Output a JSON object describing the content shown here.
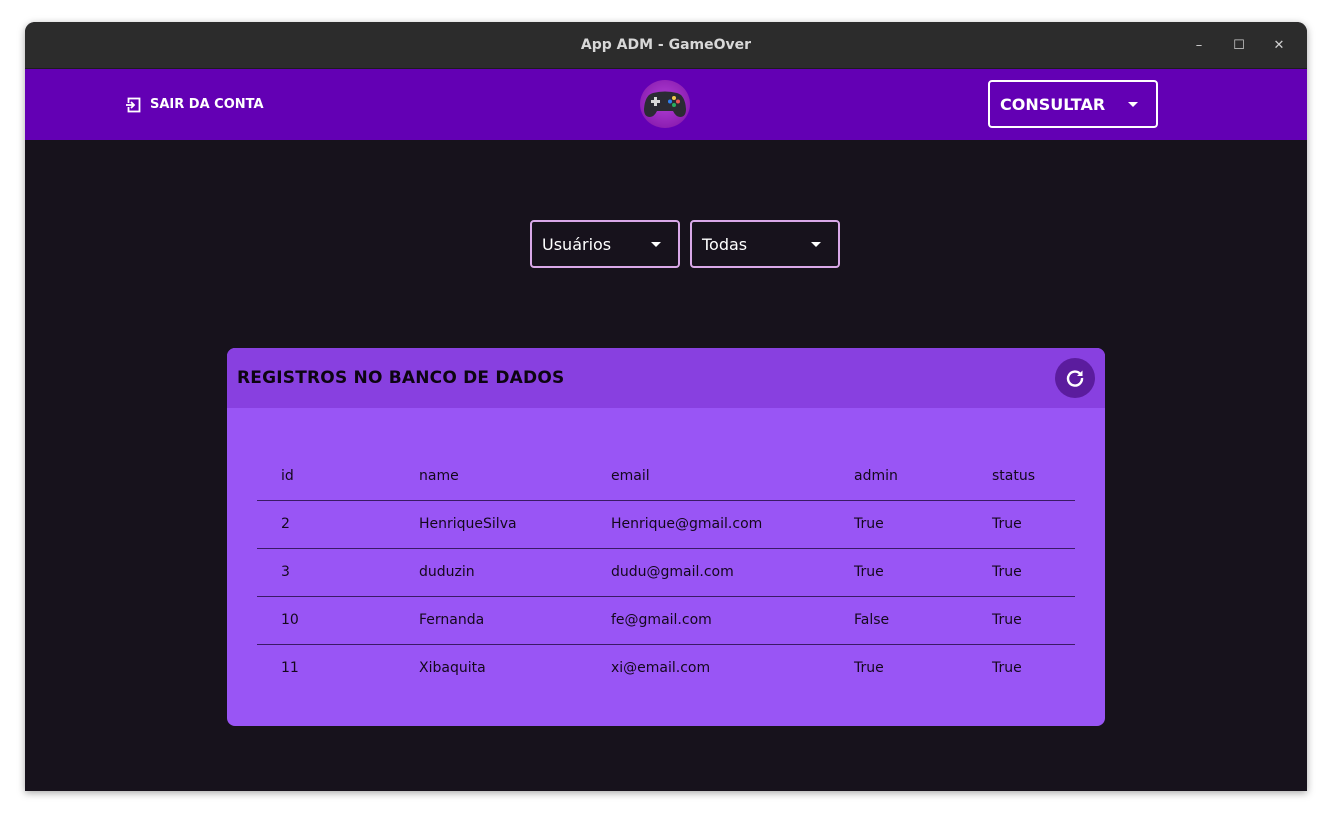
{
  "window": {
    "title": "App ADM - GameOver"
  },
  "window_controls": {
    "minimize": "–",
    "maximize": "☐",
    "close": "✕"
  },
  "appbar": {
    "logout_label": "SAIR DA CONTA",
    "logo_icon": "gamepad-icon",
    "menu_selected": "CONSULTAR"
  },
  "filters": {
    "entity_selected": "Usuários",
    "scope_selected": "Todas"
  },
  "table_card": {
    "title": "REGISTROS NO BANCO DE DADOS",
    "refresh_icon": "refresh-icon",
    "columns": [
      "id",
      "name",
      "email",
      "admin",
      "status"
    ],
    "rows": [
      [
        "2",
        "HenriqueSilva",
        "Henrique@gmail.com",
        "True",
        "True"
      ],
      [
        "3",
        "duduzin",
        "dudu@gmail.com",
        "True",
        "True"
      ],
      [
        "10",
        "Fernanda",
        "fe@gmail.com",
        "False",
        "True"
      ],
      [
        "11",
        "Xibaquita",
        "xi@email.com",
        "True",
        "True"
      ]
    ]
  },
  "colors": {
    "appbar": "#6300b4",
    "background": "#17121c",
    "card": "#9955f5",
    "card_header": "#8840e0"
  }
}
